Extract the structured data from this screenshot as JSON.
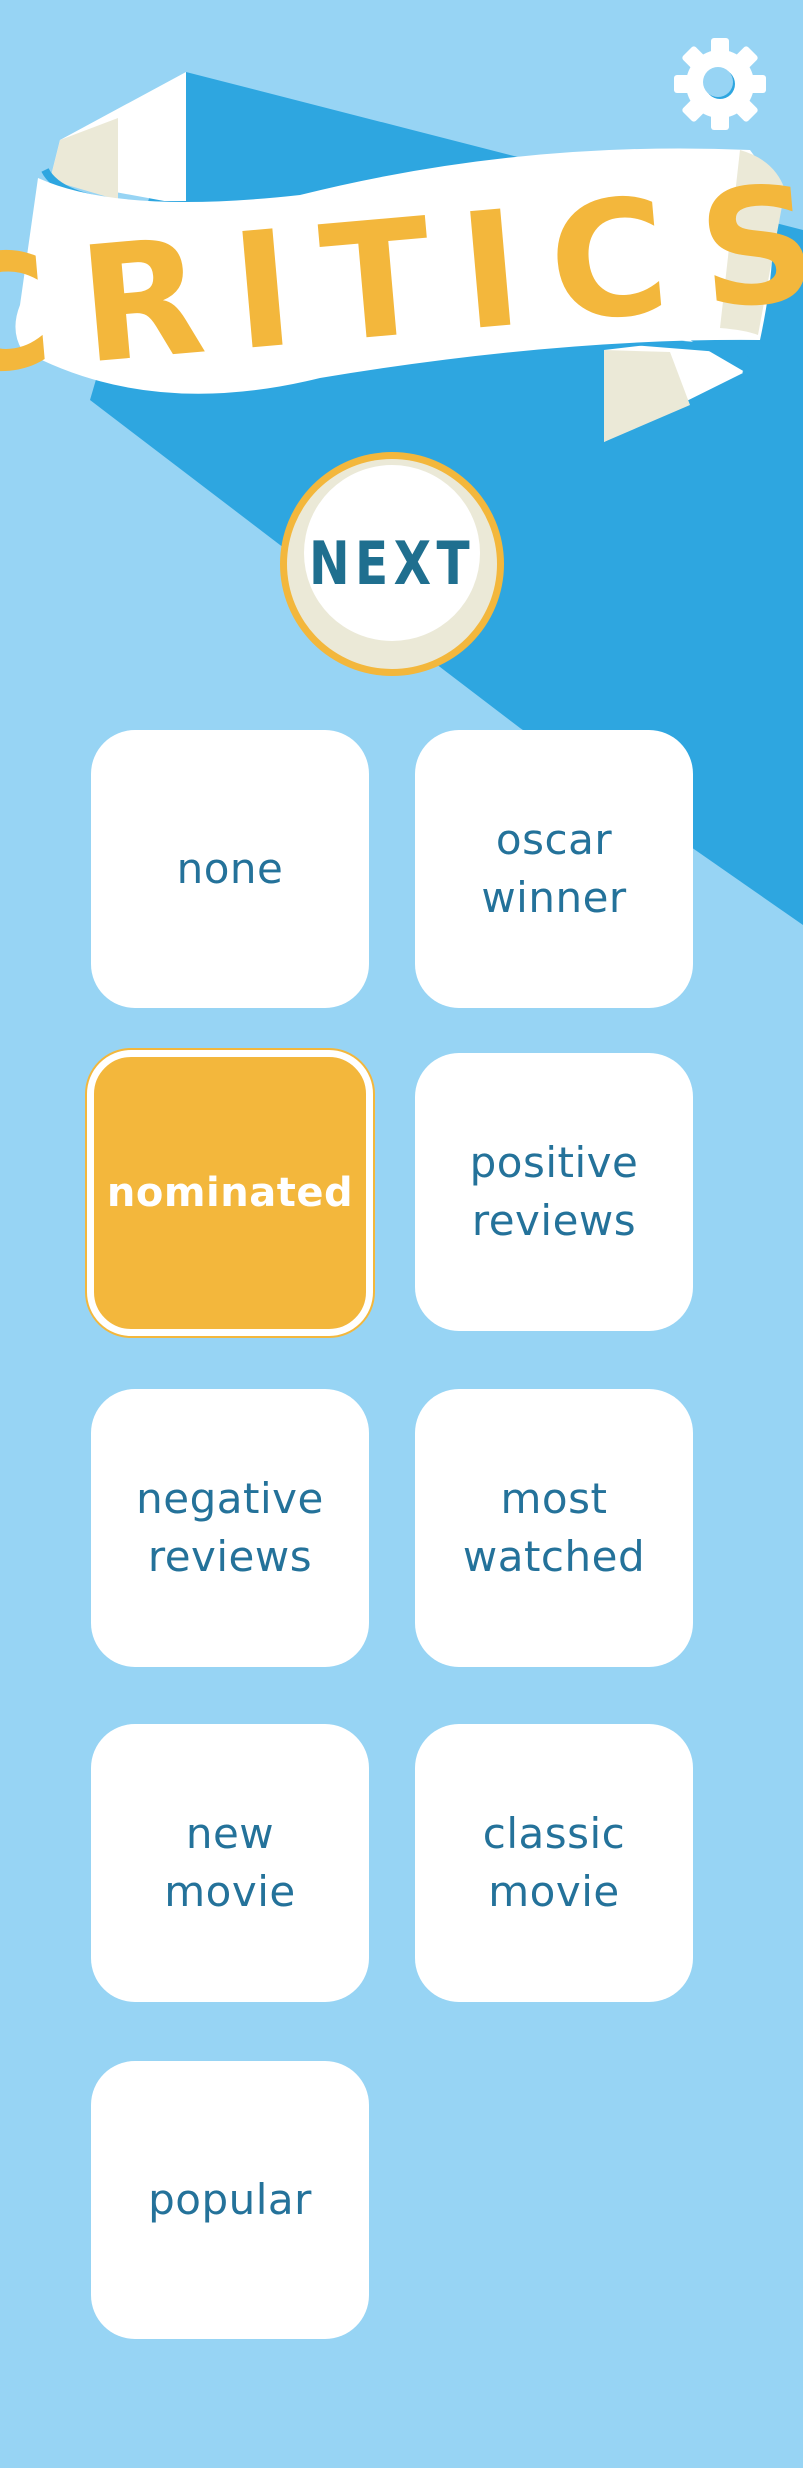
{
  "screen": {
    "title": "CRITICS",
    "next_label": "NEXT"
  },
  "colors": {
    "background": "#97d4f4",
    "shadow_blue": "#2ea6e0",
    "accent_yellow": "#f3b73c",
    "text_blue": "#24729a",
    "banner_cream": "#ebe9d7"
  },
  "icons": {
    "settings": "gear-icon"
  },
  "options": [
    {
      "label": "none",
      "selected": false
    },
    {
      "label": "oscar\nwinner",
      "selected": false
    },
    {
      "label": "nominated",
      "selected": true
    },
    {
      "label": "positive\nreviews",
      "selected": false
    },
    {
      "label": "negative\nreviews",
      "selected": false
    },
    {
      "label": "most\nwatched",
      "selected": false
    },
    {
      "label": "new\nmovie",
      "selected": false
    },
    {
      "label": "classic\nmovie",
      "selected": false
    },
    {
      "label": "popular",
      "selected": false
    }
  ]
}
